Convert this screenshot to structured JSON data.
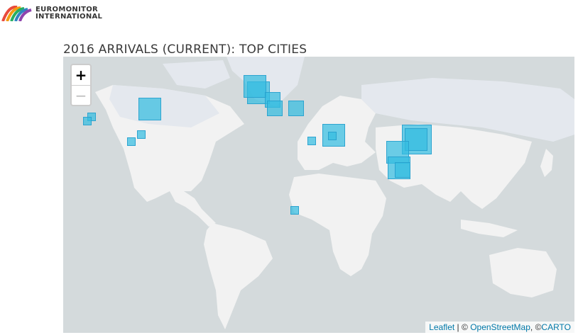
{
  "logo": {
    "line1": "EUROMONITOR",
    "line2": "INTERNATIONAL"
  },
  "title": "2016 ARRIVALS (CURRENT): TOP CITIES",
  "zoom": {
    "in": "+",
    "out": "−"
  },
  "attribution": {
    "leaflet": "Leaflet",
    "sep1": " | © ",
    "osm": "OpenStreetMap",
    "sep2": ", ©",
    "carto": "CARTO"
  },
  "colors": {
    "marker": "#35bce1",
    "land": "#f2f2f2",
    "water": "#d4dadc",
    "ice": "#e4e8ee"
  },
  "markers": [
    {
      "region": "western-europe",
      "lat": 48.9,
      "lon": 2.4,
      "size": "large"
    },
    {
      "region": "western-europe",
      "lat": 51.5,
      "lon": -0.1,
      "size": "large"
    },
    {
      "region": "southern-europe",
      "lat": 45.3,
      "lon": 12.3,
      "size": "medium"
    },
    {
      "region": "southern-europe",
      "lat": 40.8,
      "lon": 14.2,
      "size": "medium"
    },
    {
      "region": "turkey",
      "lat": 41.0,
      "lon": 28.9,
      "size": "medium"
    },
    {
      "region": "north-america-east",
      "lat": 40.7,
      "lon": -74.0,
      "size": "large"
    },
    {
      "region": "north-america-west",
      "lat": 36.1,
      "lon": -115.2,
      "size": "small"
    },
    {
      "region": "north-america-west",
      "lat": 34.0,
      "lon": -118.2,
      "size": "small"
    },
    {
      "region": "caribbean",
      "lat": 25.8,
      "lon": -80.2,
      "size": "small"
    },
    {
      "region": "mexico",
      "lat": 21.2,
      "lon": -86.8,
      "size": "small"
    },
    {
      "region": "middle-east",
      "lat": 25.2,
      "lon": 55.3,
      "size": "large"
    },
    {
      "region": "middle-east",
      "lat": 24.5,
      "lon": 54.4,
      "size": "small"
    },
    {
      "region": "middle-east",
      "lat": 21.4,
      "lon": 39.8,
      "size": "small"
    },
    {
      "region": "east-asia",
      "lat": 22.3,
      "lon": 114.2,
      "size": "xlarge"
    },
    {
      "region": "east-asia",
      "lat": 22.2,
      "lon": 113.5,
      "size": "large"
    },
    {
      "region": "southeast-asia",
      "lat": 13.8,
      "lon": 100.5,
      "size": "large"
    },
    {
      "region": "southeast-asia",
      "lat": 3.1,
      "lon": 101.7,
      "size": "large"
    },
    {
      "region": "southeast-asia",
      "lat": 1.3,
      "lon": 103.8,
      "size": "medium"
    },
    {
      "region": "southern-africa",
      "lat": -26.2,
      "lon": 28.0,
      "size": "small"
    }
  ]
}
